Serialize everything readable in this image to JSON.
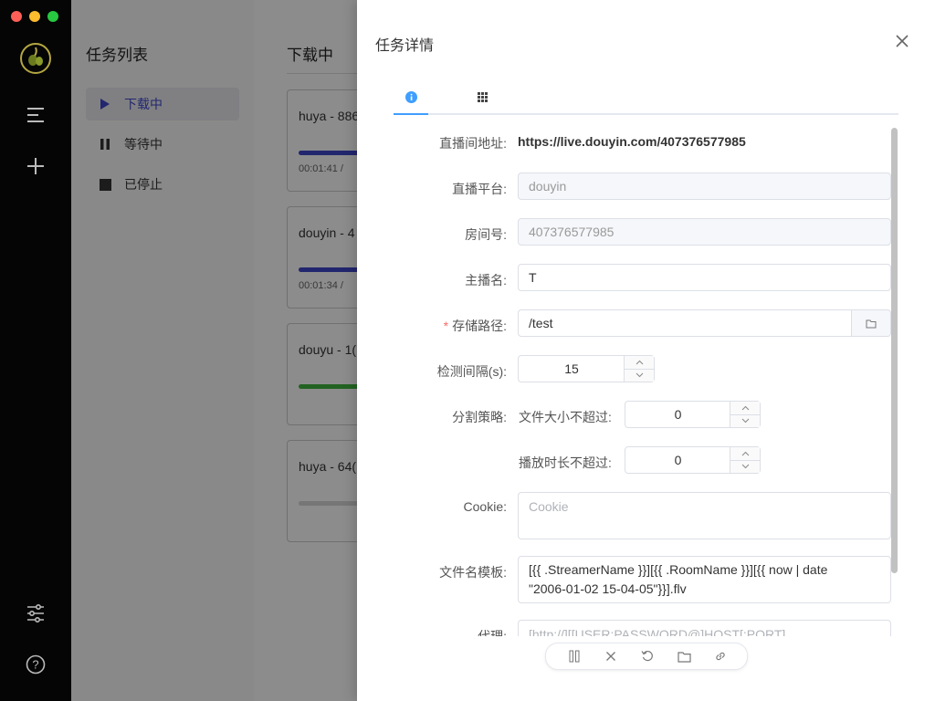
{
  "sidebar": {
    "traffic_lights": {
      "close_color": "#ff5f57",
      "minimize_color": "#febc2e",
      "zoom_color": "#28c840"
    },
    "icons": [
      "olive-logo-icon",
      "menu-icon",
      "plus-icon",
      "sliders-icon",
      "help-icon"
    ]
  },
  "tasklist": {
    "title": "任务列表",
    "items": [
      {
        "label": "下载中",
        "icon": "play-icon",
        "active": true
      },
      {
        "label": "等待中",
        "icon": "pause-icon",
        "active": false
      },
      {
        "label": "已停止",
        "icon": "stop-icon",
        "active": false
      }
    ]
  },
  "main": {
    "title": "下载中",
    "cards": [
      {
        "name": "huya - 886",
        "time": "00:01:41 / ",
        "progress": 0.45,
        "bar_color": "#3f46c8"
      },
      {
        "name": "douyin - 4",
        "time": "00:01:34 / ",
        "progress": 0.45,
        "bar_color": "#3f46c8"
      },
      {
        "name": "douyu - 1(",
        "time": "",
        "progress": 0.45,
        "bar_color": "#3fb53f"
      },
      {
        "name": "huya - 64(",
        "time": "",
        "progress": 0.45,
        "bar_color": "#d8d8d8"
      }
    ]
  },
  "drawer": {
    "title": "任务详情",
    "tabs": [
      {
        "icon": "info-icon",
        "active": true
      },
      {
        "icon": "grid-icon",
        "active": false
      }
    ],
    "form": {
      "url_label": "直播间地址:",
      "url_value": "https://live.douyin.com/407376577985",
      "platform_label": "直播平台:",
      "platform_value": "douyin",
      "room_label": "房间号:",
      "room_value": "407376577985",
      "streamer_label": "主播名:",
      "streamer_value": "T",
      "path_label": "存储路径:",
      "path_value": "/test",
      "interval_label": "检测间隔(s):",
      "interval_value": "15",
      "split_label": "分割策略:",
      "size_label": "文件大小不超过:",
      "size_value": "0",
      "duration_label": "播放时长不超过:",
      "duration_value": "0",
      "cookie_label": "Cookie:",
      "cookie_placeholder": "Cookie",
      "template_label": "文件名模板:",
      "template_line1": "[{{ .StreamerName }}][{{ .RoomName }}][{{ now | date",
      "template_line2": "\"2006-01-02 15-04-05\"}}].flv",
      "proxy_label": "代理:",
      "proxy_placeholder": "[http://][[USER:PASSWORD@]HOST[:PORT]"
    },
    "toolbar": [
      "pause-icon",
      "close-icon",
      "refresh-icon",
      "folder-icon",
      "link-icon"
    ]
  },
  "colors": {
    "accent": "#409eff",
    "required": "#f56c6c",
    "active_nav": "#3f46c8"
  }
}
